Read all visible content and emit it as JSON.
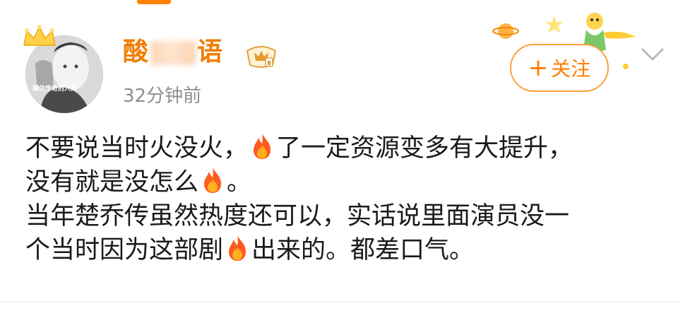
{
  "post": {
    "author": {
      "name_start": "酸",
      "name_end": "语",
      "avatar_caption": "模仿传奇的人死"
    },
    "timestamp": "32分钟前",
    "follow_label": "关注",
    "follow_prefix": "+",
    "body": {
      "line1_a": "不要说当时火没火，",
      "line1_b": "了一定资源变多有大提升，",
      "line2_a": "没有就是没怎么",
      "line2_b": "。",
      "line3": "当年楚乔传虽然热度还可以，实话说里面演员没一",
      "line4_a": "个当时因为这部剧",
      "line4_b": "出来的。都差口气。"
    }
  },
  "icons": {
    "inline_emoji": "fire-icon",
    "more": "chevron-down-icon",
    "badge": "vip-crown-badge-icon"
  },
  "colors": {
    "accent": "#ff8200",
    "username": "#f07d00",
    "follow_border": "#ff9f3e",
    "timestamp": "#8e8e8e",
    "body_text": "#1a1a1a"
  }
}
